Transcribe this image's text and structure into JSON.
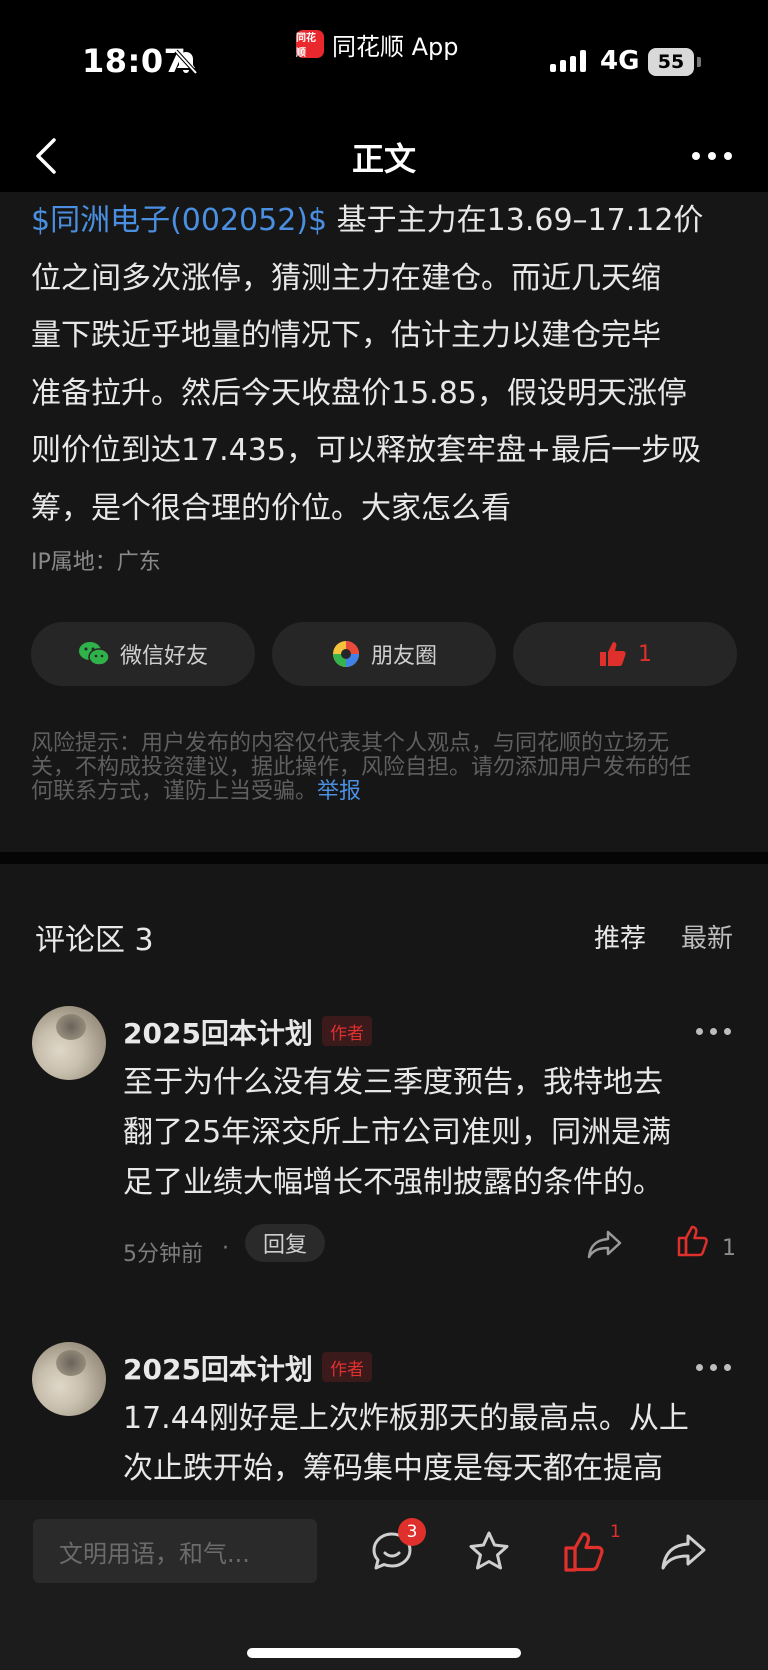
{
  "status_bar": {
    "time": "18:07",
    "app_name": "同花顺 App",
    "app_logo_text": "同花顺",
    "network": "4G",
    "battery": "55"
  },
  "nav": {
    "title": "正文"
  },
  "post": {
    "stock_tag": "$同洲电子(002052)$",
    "body_lines": [
      " 基于主力在13.69–17.12价",
      "位之间多次涨停，猜测主力在建仓。而近几天缩",
      "量下跌近乎地量的情况下，估计主力以建仓完毕",
      "准备拉升。然后今天收盘价15.85，假设明天涨停",
      "则价位到达17.435，可以释放套牢盘+最后一步吸",
      "筹，是个很合理的价位。大家怎么看"
    ],
    "ip_location": "IP属地：广东"
  },
  "share": {
    "wechat_label": "微信好友",
    "moments_label": "朋友圈",
    "like_count": "1"
  },
  "risk": {
    "lines": [
      "风险提示：用户发布的内容仅代表其个人观点，与同花顺的立场无",
      "关，不构成投资建议，据此操作，风险自担。请勿添加用户发布的任",
      "何联系方式，谨防上当受骗。"
    ],
    "report_label": "举报"
  },
  "comments_section": {
    "title": "评论区 3",
    "sort_recommended": "推荐",
    "sort_latest": "最新",
    "colors": {
      "active_sort": "#e8e8e8",
      "inactive_sort": "#bdbdbd",
      "accent_red": "#e0302c",
      "link_blue": "#4a8fe0"
    }
  },
  "comments": [
    {
      "user": "2025回本计划",
      "badge": "作者",
      "lines": [
        "至于为什么没有发三季度预告，我特地去",
        "翻了25年深交所上市公司准则，同洲是满",
        "足了业绩大幅增长不强制披露的条件的。"
      ],
      "time": "5分钟前",
      "separator": "·",
      "reply_label": "回复",
      "like_count": "1",
      "liked": true
    },
    {
      "user": "2025回本计划",
      "badge": "作者",
      "lines": [
        "17.44刚好是上次炸板那天的最高点。从上",
        "次止跌开始，筹码集中度是每天都在提高"
      ]
    }
  ],
  "bottom_bar": {
    "input_placeholder": "文明用语，和气...",
    "comment_badge": "3",
    "like_count": "1",
    "icons": [
      "comment-icon",
      "star-icon",
      "like-icon",
      "share-icon"
    ]
  }
}
